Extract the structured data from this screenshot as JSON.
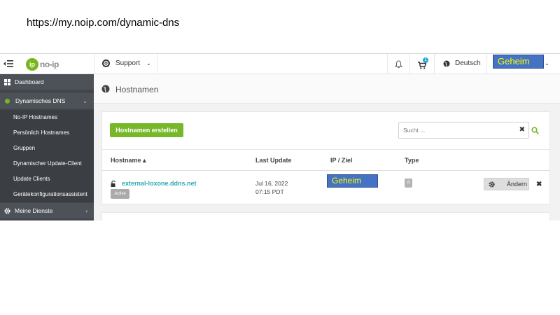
{
  "caption": {
    "url": "https://my.noip.com/dynamic-dns"
  },
  "topbar": {
    "logo_text": "no-ip",
    "support_label": "Support",
    "cart_count": "1",
    "language": "Deutsch",
    "user_redacted": "Geheim"
  },
  "sidebar": {
    "items": [
      {
        "label": "Dashboard"
      },
      {
        "label": "Dynamisches DNS"
      },
      {
        "label": "No-IP Hostnames"
      },
      {
        "label": "Persönlich Hostnames"
      },
      {
        "label": "Gruppen"
      },
      {
        "label": "Dynamischer Update-Client"
      },
      {
        "label": "Update Clients"
      },
      {
        "label": "Gerätekonfigurationsassistent"
      },
      {
        "label": "Meine Dienste"
      }
    ]
  },
  "main": {
    "title": "Hostnamen",
    "create_button": "Hostnamen erstellen",
    "search_placeholder": "Sucht ...",
    "columns": {
      "hostname": "Hostname ▴",
      "last_update": "Last Update",
      "ip": "IP / Ziel",
      "type": "Type"
    },
    "rows": [
      {
        "hostname": "external-loxone.ddns.net",
        "status": "Active",
        "date": "Jul 16, 2022",
        "time": "07:15 PDT",
        "ip_redacted": "Geheim",
        "type": "A",
        "edit_label": "Ändern"
      }
    ]
  },
  "colors": {
    "accent_green": "#77b82b",
    "sidebar_bg": "#43474c",
    "link_teal": "#2ba7b8",
    "redaction_blue": "#4472c4",
    "redaction_text": "#ffff00"
  }
}
